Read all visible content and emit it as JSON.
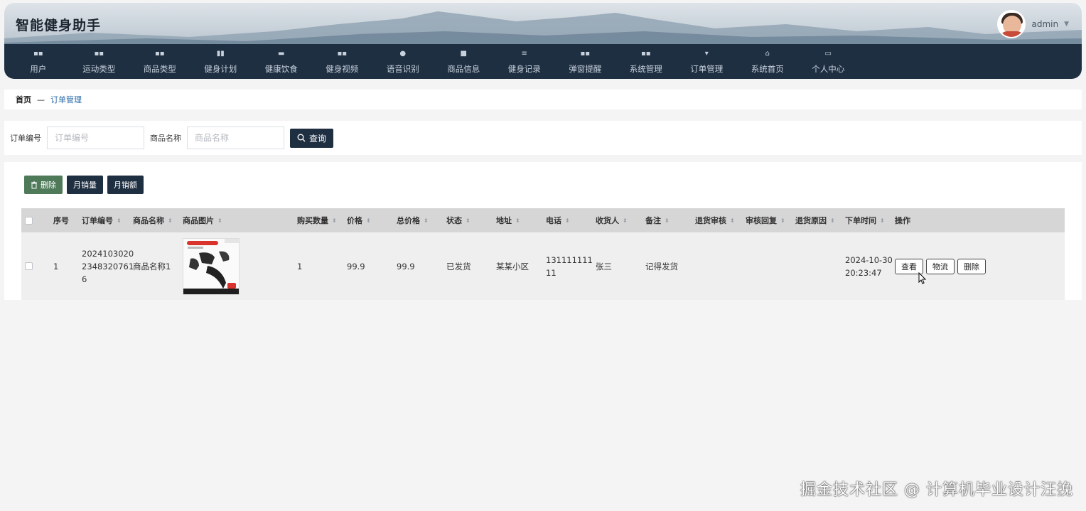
{
  "app": {
    "title": "智能健身助手",
    "username": "admin"
  },
  "nav": [
    {
      "label": "用户",
      "icon": "grid-icon"
    },
    {
      "label": "运动类型",
      "icon": "grid-icon"
    },
    {
      "label": "商品类型",
      "icon": "grid-icon"
    },
    {
      "label": "健身计划",
      "icon": "bar-chart-icon"
    },
    {
      "label": "健康饮食",
      "icon": "chat-icon"
    },
    {
      "label": "健身视频",
      "icon": "grid-icon"
    },
    {
      "label": "语音识别",
      "icon": "user-icon"
    },
    {
      "label": "商品信息",
      "icon": "briefcase-icon"
    },
    {
      "label": "健身记录",
      "icon": "sliders-icon"
    },
    {
      "label": "弹窗提醒",
      "icon": "grid-icon"
    },
    {
      "label": "系统管理",
      "icon": "grid-icon"
    },
    {
      "label": "订单管理",
      "icon": "pin-icon"
    },
    {
      "label": "系统首页",
      "icon": "home-icon"
    },
    {
      "label": "个人中心",
      "icon": "window-icon"
    }
  ],
  "breadcrumb": {
    "home": "首页",
    "sep": "—",
    "current": "订单管理"
  },
  "search": {
    "order_no_label": "订单编号",
    "order_no_placeholder": "订单编号",
    "product_label": "商品名称",
    "product_placeholder": "商品名称",
    "query_label": "查询"
  },
  "actions": {
    "delete": "删除",
    "monthly_sales": "月销量",
    "monthly_revenue": "月销额"
  },
  "table": {
    "headers": {
      "index": "序号",
      "order_no": "订单编号",
      "product": "商品名称",
      "image": "商品图片",
      "qty": "购买数量",
      "price": "价格",
      "total": "总价格",
      "status": "状态",
      "address": "地址",
      "phone": "电话",
      "receiver": "收货人",
      "remark": "备注",
      "return_review": "退货审核",
      "review_reply": "审核回复",
      "return_reason": "退货原因",
      "order_time": "下单时间",
      "ops": "操作"
    },
    "rows": [
      {
        "index": "1",
        "order_no_l1": "2024103020",
        "order_no_l2": "2348320761",
        "order_no_l3": "6",
        "product": "商品名称1",
        "qty": "1",
        "price": "99.9",
        "total": "99.9",
        "status": "已发货",
        "address": "某某小区",
        "phone_l1": "131111111",
        "phone_l2": "11",
        "receiver": "张三",
        "remark": "记得发货",
        "return_review": "",
        "review_reply": "",
        "return_reason": "",
        "time_l1": "2024-10-30",
        "time_l2": "20:23:47",
        "btn_view": "查看",
        "btn_logistics": "物流",
        "btn_delete": "删除"
      }
    ]
  },
  "watermark": "掘金技术社区 @ 计算机毕业设计汪挽"
}
